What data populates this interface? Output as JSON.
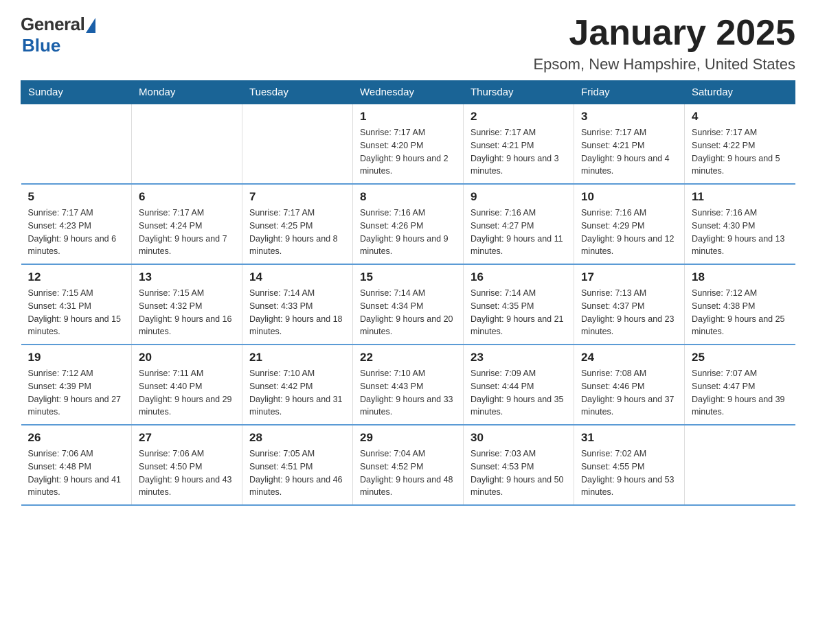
{
  "logo": {
    "general": "General",
    "blue": "Blue"
  },
  "title": "January 2025",
  "location": "Epsom, New Hampshire, United States",
  "weekdays": [
    "Sunday",
    "Monday",
    "Tuesday",
    "Wednesday",
    "Thursday",
    "Friday",
    "Saturday"
  ],
  "weeks": [
    [
      {
        "day": "",
        "info": ""
      },
      {
        "day": "",
        "info": ""
      },
      {
        "day": "",
        "info": ""
      },
      {
        "day": "1",
        "info": "Sunrise: 7:17 AM\nSunset: 4:20 PM\nDaylight: 9 hours and 2 minutes."
      },
      {
        "day": "2",
        "info": "Sunrise: 7:17 AM\nSunset: 4:21 PM\nDaylight: 9 hours and 3 minutes."
      },
      {
        "day": "3",
        "info": "Sunrise: 7:17 AM\nSunset: 4:21 PM\nDaylight: 9 hours and 4 minutes."
      },
      {
        "day": "4",
        "info": "Sunrise: 7:17 AM\nSunset: 4:22 PM\nDaylight: 9 hours and 5 minutes."
      }
    ],
    [
      {
        "day": "5",
        "info": "Sunrise: 7:17 AM\nSunset: 4:23 PM\nDaylight: 9 hours and 6 minutes."
      },
      {
        "day": "6",
        "info": "Sunrise: 7:17 AM\nSunset: 4:24 PM\nDaylight: 9 hours and 7 minutes."
      },
      {
        "day": "7",
        "info": "Sunrise: 7:17 AM\nSunset: 4:25 PM\nDaylight: 9 hours and 8 minutes."
      },
      {
        "day": "8",
        "info": "Sunrise: 7:16 AM\nSunset: 4:26 PM\nDaylight: 9 hours and 9 minutes."
      },
      {
        "day": "9",
        "info": "Sunrise: 7:16 AM\nSunset: 4:27 PM\nDaylight: 9 hours and 11 minutes."
      },
      {
        "day": "10",
        "info": "Sunrise: 7:16 AM\nSunset: 4:29 PM\nDaylight: 9 hours and 12 minutes."
      },
      {
        "day": "11",
        "info": "Sunrise: 7:16 AM\nSunset: 4:30 PM\nDaylight: 9 hours and 13 minutes."
      }
    ],
    [
      {
        "day": "12",
        "info": "Sunrise: 7:15 AM\nSunset: 4:31 PM\nDaylight: 9 hours and 15 minutes."
      },
      {
        "day": "13",
        "info": "Sunrise: 7:15 AM\nSunset: 4:32 PM\nDaylight: 9 hours and 16 minutes."
      },
      {
        "day": "14",
        "info": "Sunrise: 7:14 AM\nSunset: 4:33 PM\nDaylight: 9 hours and 18 minutes."
      },
      {
        "day": "15",
        "info": "Sunrise: 7:14 AM\nSunset: 4:34 PM\nDaylight: 9 hours and 20 minutes."
      },
      {
        "day": "16",
        "info": "Sunrise: 7:14 AM\nSunset: 4:35 PM\nDaylight: 9 hours and 21 minutes."
      },
      {
        "day": "17",
        "info": "Sunrise: 7:13 AM\nSunset: 4:37 PM\nDaylight: 9 hours and 23 minutes."
      },
      {
        "day": "18",
        "info": "Sunrise: 7:12 AM\nSunset: 4:38 PM\nDaylight: 9 hours and 25 minutes."
      }
    ],
    [
      {
        "day": "19",
        "info": "Sunrise: 7:12 AM\nSunset: 4:39 PM\nDaylight: 9 hours and 27 minutes."
      },
      {
        "day": "20",
        "info": "Sunrise: 7:11 AM\nSunset: 4:40 PM\nDaylight: 9 hours and 29 minutes."
      },
      {
        "day": "21",
        "info": "Sunrise: 7:10 AM\nSunset: 4:42 PM\nDaylight: 9 hours and 31 minutes."
      },
      {
        "day": "22",
        "info": "Sunrise: 7:10 AM\nSunset: 4:43 PM\nDaylight: 9 hours and 33 minutes."
      },
      {
        "day": "23",
        "info": "Sunrise: 7:09 AM\nSunset: 4:44 PM\nDaylight: 9 hours and 35 minutes."
      },
      {
        "day": "24",
        "info": "Sunrise: 7:08 AM\nSunset: 4:46 PM\nDaylight: 9 hours and 37 minutes."
      },
      {
        "day": "25",
        "info": "Sunrise: 7:07 AM\nSunset: 4:47 PM\nDaylight: 9 hours and 39 minutes."
      }
    ],
    [
      {
        "day": "26",
        "info": "Sunrise: 7:06 AM\nSunset: 4:48 PM\nDaylight: 9 hours and 41 minutes."
      },
      {
        "day": "27",
        "info": "Sunrise: 7:06 AM\nSunset: 4:50 PM\nDaylight: 9 hours and 43 minutes."
      },
      {
        "day": "28",
        "info": "Sunrise: 7:05 AM\nSunset: 4:51 PM\nDaylight: 9 hours and 46 minutes."
      },
      {
        "day": "29",
        "info": "Sunrise: 7:04 AM\nSunset: 4:52 PM\nDaylight: 9 hours and 48 minutes."
      },
      {
        "day": "30",
        "info": "Sunrise: 7:03 AM\nSunset: 4:53 PM\nDaylight: 9 hours and 50 minutes."
      },
      {
        "day": "31",
        "info": "Sunrise: 7:02 AM\nSunset: 4:55 PM\nDaylight: 9 hours and 53 minutes."
      },
      {
        "day": "",
        "info": ""
      }
    ]
  ]
}
